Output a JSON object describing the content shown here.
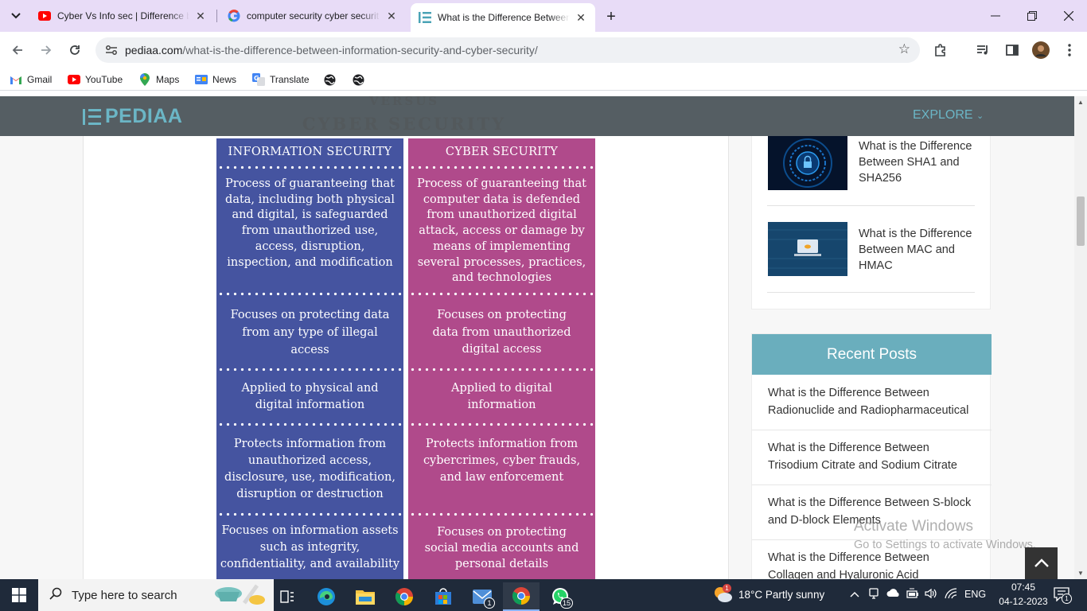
{
  "browser": {
    "tabs": [
      {
        "title": "Cyber Vs Info sec | Difference b",
        "favicon": "youtube-icon"
      },
      {
        "title": "computer security cyber securit",
        "favicon": "google-icon"
      },
      {
        "title": "What is the Difference Between",
        "favicon": "pediaa-icon"
      }
    ],
    "url_host": "pediaa.com",
    "url_path": "/what-is-the-difference-between-information-security-and-cyber-security/",
    "bookmarks": [
      "Gmail",
      "YouTube",
      "Maps",
      "News",
      "Translate"
    ]
  },
  "site": {
    "logo": "PEDIAA",
    "explore": "EXPLORE",
    "behind_header_1": "VERSUS",
    "behind_header_2": "CYBER SECURITY"
  },
  "comparison": {
    "left_title": "INFORMATION SECURITY",
    "right_title": "CYBER SECURITY",
    "rows": [
      {
        "left": [
          "Process of guaranteeing that",
          "data, including both physical",
          "and digital, is safeguarded",
          "from unauthorized use,",
          "access, disruption,",
          "inspection, and modification"
        ],
        "right": [
          "Process of guaranteeing that",
          "computer data is defended",
          "from unauthorized digital",
          "attack, access or damage by",
          "means of implementing",
          "several processes, practices,",
          "and technologies"
        ]
      },
      {
        "left": [
          "Focuses on protecting data",
          "from any type of illegal",
          "access"
        ],
        "right": [
          "Focuses on protecting",
          "data from unauthorized",
          "digital access"
        ]
      },
      {
        "left": [
          "Applied to physical and",
          "digital information"
        ],
        "right": [
          "Applied to digital",
          "information"
        ]
      },
      {
        "left": [
          "Protects information from",
          "unauthorized access,",
          "disclosure, use, modification,",
          "disruption or destruction"
        ],
        "right": [
          "Protects information from",
          "cybercrimes, cyber frauds,",
          "and law enforcement"
        ]
      },
      {
        "left": [
          "Focuses on information assets",
          "such as integrity,",
          "confidentiality, and availability"
        ],
        "right": [
          "Focuses on protecting",
          "social media accounts and",
          "personal details"
        ]
      }
    ]
  },
  "sidebar": {
    "related": [
      {
        "title": "What is the Difference Between SHA1 and SHA256"
      },
      {
        "title": "What is the Difference Between MAC and HMAC"
      }
    ],
    "recent_title": "Recent Posts",
    "recent": [
      "What is the Difference Between Radionuclide and Radiopharmaceutical",
      "What is the Difference Between Trisodium Citrate and Sodium Citrate",
      "What is the Difference Between S-block and D-block Elements",
      "What is the Difference Between Collagen and Hyaluronic Acid"
    ]
  },
  "watermark": {
    "line1": "Activate Windows",
    "line2": "Go to Settings to activate Windows."
  },
  "taskbar": {
    "search_placeholder": "Type here to search",
    "weather": "18°C  Partly sunny",
    "language": "ENG",
    "time": "07:45",
    "date": "04-12-2023",
    "mail_badge": "1",
    "whatsapp_badge": "15",
    "weather_badge": "1",
    "notif_badge": "1"
  }
}
